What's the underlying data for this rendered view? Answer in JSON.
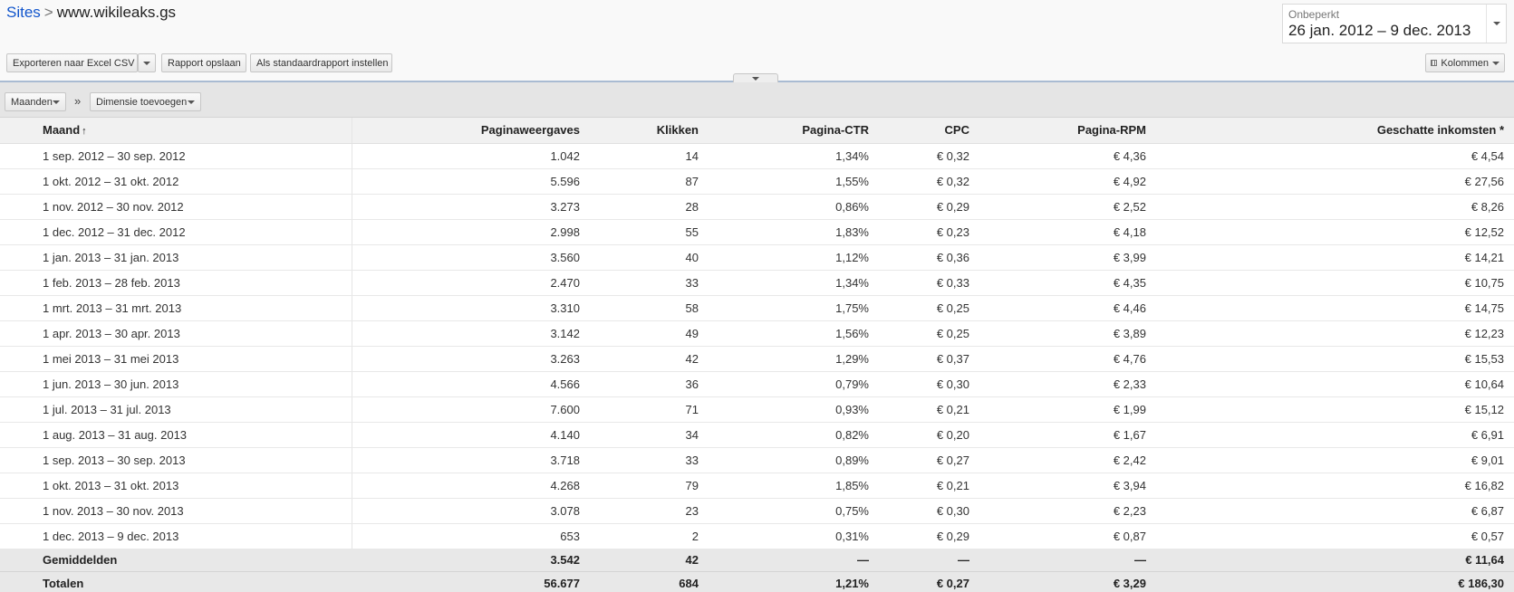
{
  "breadcrumb": {
    "root": "Sites",
    "separator": ">",
    "current": "www.wikileaks.gs"
  },
  "date_range": {
    "label": "Onbeperkt",
    "range": "26 jan. 2012 – 9 dec. 2013"
  },
  "toolbar": {
    "export_label": "Exporteren naar Excel CSV",
    "save_label": "Rapport opslaan",
    "default_label": "Als standaardrapport instellen",
    "columns_label": "Kolommen"
  },
  "dimensions": {
    "primary": "Maanden",
    "separator": "»",
    "add": "Dimensie toevoegen"
  },
  "table": {
    "sort_indicator": "↑",
    "columns": [
      "Maand",
      "Paginaweergaves",
      "Klikken",
      "Pagina-CTR",
      "CPC",
      "Pagina-RPM",
      "Geschatte inkomsten *"
    ],
    "rows": [
      [
        "1 sep. 2012 – 30 sep. 2012",
        "1.042",
        "14",
        "1,34%",
        "€ 0,32",
        "€ 4,36",
        "€ 4,54"
      ],
      [
        "1 okt. 2012 – 31 okt. 2012",
        "5.596",
        "87",
        "1,55%",
        "€ 0,32",
        "€ 4,92",
        "€ 27,56"
      ],
      [
        "1 nov. 2012 – 30 nov. 2012",
        "3.273",
        "28",
        "0,86%",
        "€ 0,29",
        "€ 2,52",
        "€ 8,26"
      ],
      [
        "1 dec. 2012 – 31 dec. 2012",
        "2.998",
        "55",
        "1,83%",
        "€ 0,23",
        "€ 4,18",
        "€ 12,52"
      ],
      [
        "1 jan. 2013 – 31 jan. 2013",
        "3.560",
        "40",
        "1,12%",
        "€ 0,36",
        "€ 3,99",
        "€ 14,21"
      ],
      [
        "1 feb. 2013 – 28 feb. 2013",
        "2.470",
        "33",
        "1,34%",
        "€ 0,33",
        "€ 4,35",
        "€ 10,75"
      ],
      [
        "1 mrt. 2013 – 31 mrt. 2013",
        "3.310",
        "58",
        "1,75%",
        "€ 0,25",
        "€ 4,46",
        "€ 14,75"
      ],
      [
        "1 apr. 2013 – 30 apr. 2013",
        "3.142",
        "49",
        "1,56%",
        "€ 0,25",
        "€ 3,89",
        "€ 12,23"
      ],
      [
        "1 mei 2013 – 31 mei 2013",
        "3.263",
        "42",
        "1,29%",
        "€ 0,37",
        "€ 4,76",
        "€ 15,53"
      ],
      [
        "1 jun. 2013 – 30 jun. 2013",
        "4.566",
        "36",
        "0,79%",
        "€ 0,30",
        "€ 2,33",
        "€ 10,64"
      ],
      [
        "1 jul. 2013 – 31 jul. 2013",
        "7.600",
        "71",
        "0,93%",
        "€ 0,21",
        "€ 1,99",
        "€ 15,12"
      ],
      [
        "1 aug. 2013 – 31 aug. 2013",
        "4.140",
        "34",
        "0,82%",
        "€ 0,20",
        "€ 1,67",
        "€ 6,91"
      ],
      [
        "1 sep. 2013 – 30 sep. 2013",
        "3.718",
        "33",
        "0,89%",
        "€ 0,27",
        "€ 2,42",
        "€ 9,01"
      ],
      [
        "1 okt. 2013 – 31 okt. 2013",
        "4.268",
        "79",
        "1,85%",
        "€ 0,21",
        "€ 3,94",
        "€ 16,82"
      ],
      [
        "1 nov. 2013 – 30 nov. 2013",
        "3.078",
        "23",
        "0,75%",
        "€ 0,30",
        "€ 2,23",
        "€ 6,87"
      ],
      [
        "1 dec. 2013 – 9 dec. 2013",
        "653",
        "2",
        "0,31%",
        "€ 0,29",
        "€ 0,87",
        "€ 0,57"
      ]
    ],
    "averages": [
      "Gemiddelden",
      "3.542",
      "42",
      "—",
      "—",
      "—",
      "€ 11,64"
    ],
    "totals": [
      "Totalen",
      "56.677",
      "684",
      "1,21%",
      "€ 0,27",
      "€ 3,29",
      "€ 186,30"
    ]
  }
}
